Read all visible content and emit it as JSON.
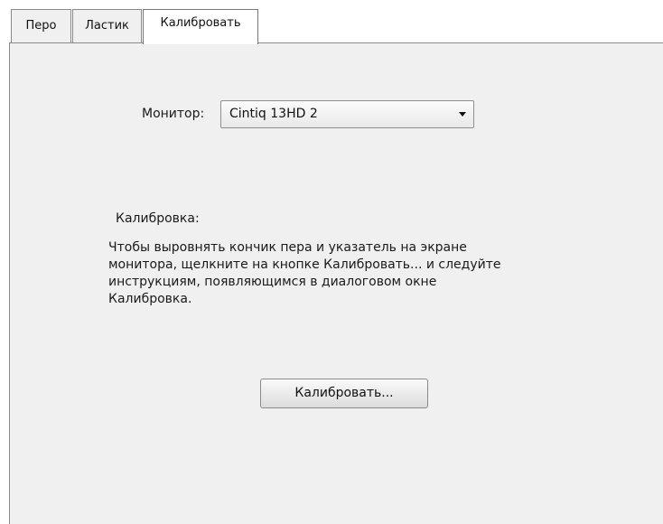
{
  "tabs": [
    {
      "label": "Перо"
    },
    {
      "label": "Ластик"
    },
    {
      "label": "Калибровать",
      "selected": true
    }
  ],
  "monitor": {
    "label": "Монитор:",
    "selected_value": "Cintiq 13HD 2"
  },
  "calibration": {
    "heading": "Калибровка:",
    "description": "Чтобы выровнять кончик пера и указатель на экране\nмонитора, щелкните на кнопке Калибровать... и следуйте\nинструкциям, появляющимся в диалоговом окне\nКалибровка.",
    "button_label": "Калибровать..."
  },
  "colors": {
    "panel_background": "#f0f0f0",
    "tab_border": "#8a8a8a"
  },
  "icons": {
    "dropdown": "chevron-down-icon"
  }
}
